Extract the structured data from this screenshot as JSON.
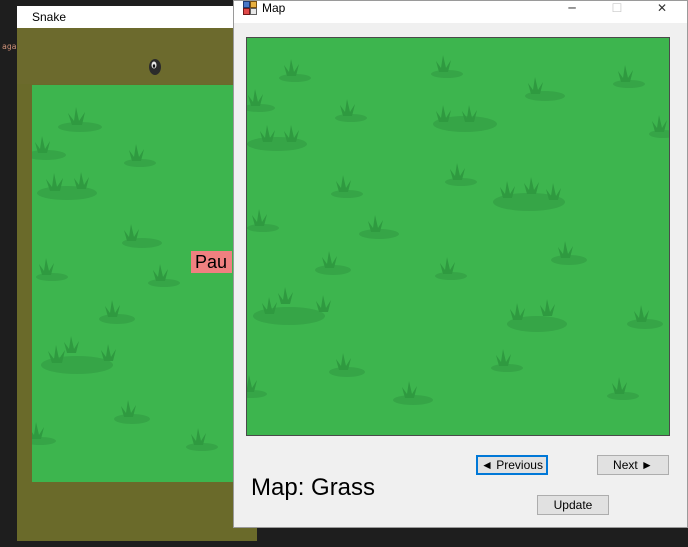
{
  "background_editor": {
    "snippet": "aga"
  },
  "snake_window": {
    "title": "Snake",
    "pause_label": "Pau",
    "colors": {
      "grass": "#3db54e",
      "wall": "#6a6a2a",
      "pause_bg": "#f08080"
    }
  },
  "map_dialog": {
    "title": "Map",
    "app_icon": "map-app-icon",
    "title_buttons": {
      "minimize": "─",
      "maximize": "☐",
      "close": "✕"
    },
    "map_name_label": "Map: Grass",
    "buttons": {
      "previous": "◄ Previous",
      "next": "Next ►",
      "update": "Update"
    },
    "colors": {
      "grass": "#3db54e",
      "grass_tuft": "#2f9a40",
      "focus_border": "#0078d7"
    }
  }
}
